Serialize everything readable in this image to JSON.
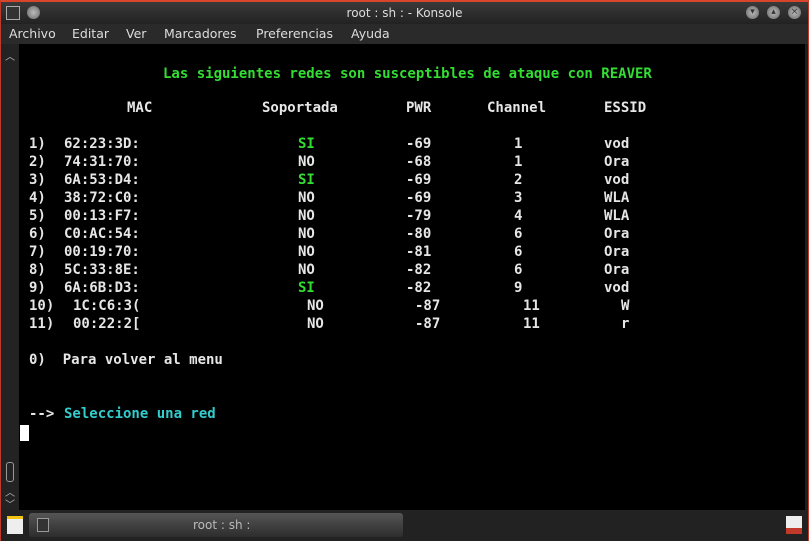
{
  "window": {
    "title": "root : sh : - Konsole"
  },
  "menu": [
    "Archivo",
    "Editar",
    "Ver",
    "Marcadores",
    "Preferencias",
    "Ayuda"
  ],
  "terminal": {
    "title": "Las siguientes redes son susceptibles de ataque con REAVER",
    "headers": {
      "mac": "MAC",
      "soportada": "Soportada",
      "pwr": "PWR",
      "channel": "Channel",
      "essid": "ESSID"
    },
    "rows": [
      {
        "n": "1)",
        "mac": "62:23:3D:",
        "sop": "SI",
        "pwr": "-69",
        "ch": "1",
        "essid": "vod"
      },
      {
        "n": "2)",
        "mac": "74:31:70:",
        "sop": "NO",
        "pwr": "-68",
        "ch": "1",
        "essid": "Ora"
      },
      {
        "n": "3)",
        "mac": "6A:53:D4:",
        "sop": "SI",
        "pwr": "-69",
        "ch": "2",
        "essid": "vod"
      },
      {
        "n": "4)",
        "mac": "38:72:C0:",
        "sop": "NO",
        "pwr": "-69",
        "ch": "3",
        "essid": "WLA"
      },
      {
        "n": "5)",
        "mac": "00:13:F7:",
        "sop": "NO",
        "pwr": "-79",
        "ch": "4",
        "essid": "WLA"
      },
      {
        "n": "6)",
        "mac": "C0:AC:54:",
        "sop": "NO",
        "pwr": "-80",
        "ch": "6",
        "essid": "Ora"
      },
      {
        "n": "7)",
        "mac": "00:19:70:",
        "sop": "NO",
        "pwr": "-81",
        "ch": "6",
        "essid": "Ora"
      },
      {
        "n": "8)",
        "mac": "5C:33:8E:",
        "sop": "NO",
        "pwr": "-82",
        "ch": "6",
        "essid": "Ora"
      },
      {
        "n": "9)",
        "mac": "6A:6B:D3:",
        "sop": "SI",
        "pwr": "-82",
        "ch": "9",
        "essid": "vod"
      },
      {
        "n": "10)",
        "mac": "1C:C6:3(",
        "sop": "NO",
        "pwr": "-87",
        "ch": "11",
        "essid": "W"
      },
      {
        "n": "11)",
        "mac": "00:22:2[",
        "sop": "NO",
        "pwr": "-87",
        "ch": "11",
        "essid": "r"
      }
    ],
    "back_option": "0)  Para volver al menu",
    "prompt_arrow": "-->",
    "prompt_text": "Seleccione una red"
  },
  "tabs": [
    {
      "label": "root : sh :"
    }
  ],
  "colors": {
    "green": "#33dd33",
    "cyan": "#33cccc",
    "frame": "#d9442c"
  }
}
